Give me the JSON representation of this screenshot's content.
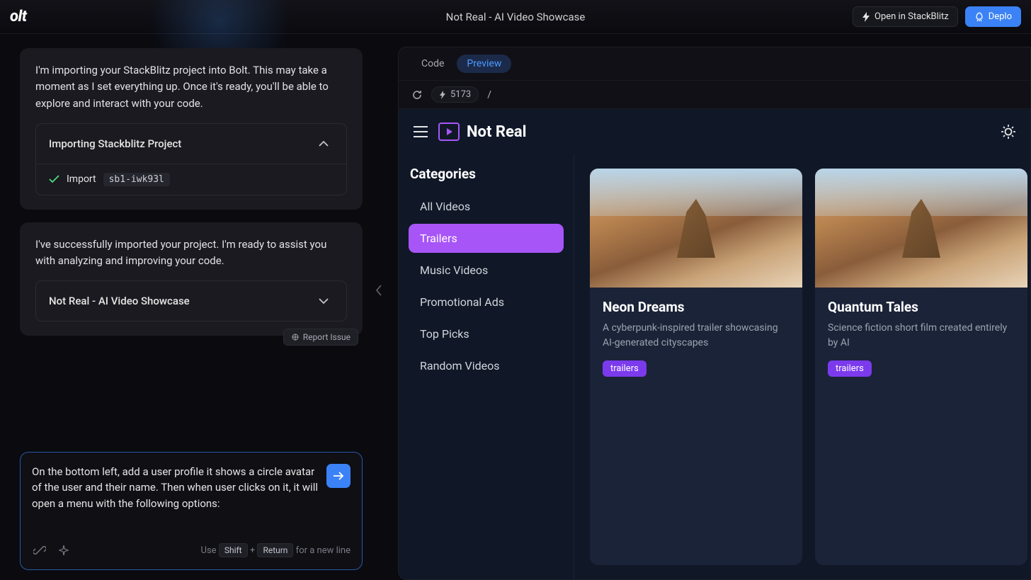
{
  "topbar": {
    "logo": "olt",
    "title": "Not Real - AI Video Showcase",
    "open_stackblitz": "Open in StackBlitz",
    "deploy": "Deplo"
  },
  "chat": {
    "msg1": "I'm importing your StackBlitz project into Bolt. This may take a moment as I set everything up. Once it's ready, you'll be able to explore and interact with your code.",
    "card1_title": "Importing Stackblitz Project",
    "import_label": "Import",
    "import_code": "sb1-iwk93l",
    "msg2": "I've successfully imported your project. I'm ready to assist you with analyzing and improving your code.",
    "card2_title": "Not Real - AI Video Showcase",
    "report_issue": "Report Issue"
  },
  "input": {
    "text": "On the bottom left, add a user profile it shows a circle avatar of the user and their name. Then when user clicks on it, it will open a menu with the following options:",
    "use": "Use",
    "shift": "Shift",
    "plus": "+",
    "return": "Return",
    "newline": "for a new line"
  },
  "preview": {
    "tab_code": "Code",
    "tab_preview": "Preview",
    "port": "5173",
    "path": "/"
  },
  "app": {
    "name": "Not Real",
    "categories_title": "Categories",
    "categories": [
      "All Videos",
      "Trailers",
      "Music Videos",
      "Promotional Ads",
      "Top Picks",
      "Random Videos"
    ],
    "active_category_index": 1,
    "videos": [
      {
        "title": "Neon Dreams",
        "desc": "A cyberpunk-inspired trailer showcasing AI-generated cityscapes",
        "tag": "trailers"
      },
      {
        "title": "Quantum Tales",
        "desc": "Science fiction short film created entirely by AI",
        "tag": "trailers"
      }
    ]
  }
}
